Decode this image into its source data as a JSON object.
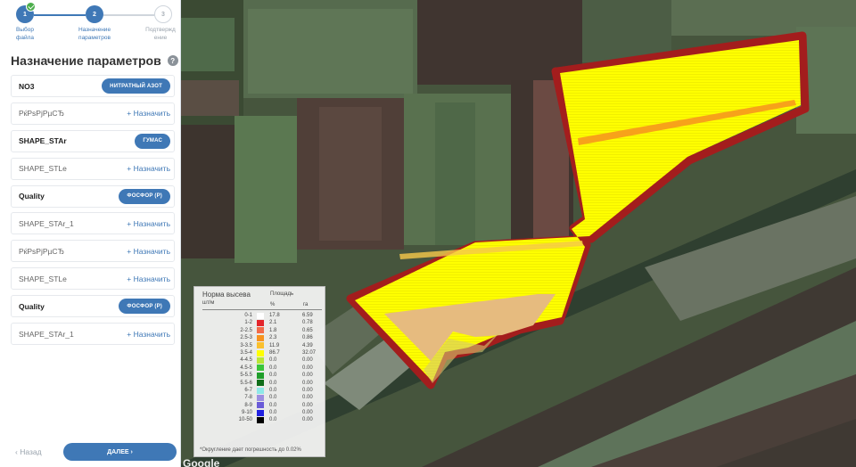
{
  "stepper": {
    "steps": [
      {
        "number": "1",
        "label_line1": "Выбор",
        "label_line2": "файла",
        "state": "done"
      },
      {
        "number": "2",
        "label_line1": "Назначение",
        "label_line2": "параметров",
        "state": "active"
      },
      {
        "number": "3",
        "label_line1": "Подтвержд",
        "label_line2": "ение",
        "state": "pending"
      }
    ]
  },
  "panel": {
    "title": "Назначение параметров",
    "help_icon": "?",
    "assign_label": "+ Назначить",
    "params": [
      {
        "name": "NO3",
        "assigned": true,
        "pill": "НИТРАТНЫЙ АЗОТ"
      },
      {
        "name": "РќРѕРјРµСЂ",
        "assigned": false
      },
      {
        "name": "SHAPE_STAr",
        "assigned": true,
        "pill": "ГУМАС"
      },
      {
        "name": "SHAPE_STLe",
        "assigned": false
      },
      {
        "name": "Quality",
        "assigned": true,
        "pill": "ФОСФОР (P)"
      },
      {
        "name": "SHAPE_STAr_1",
        "assigned": false
      },
      {
        "name": "РќРѕРјРµСЂ",
        "assigned": false
      },
      {
        "name": "SHAPE_STLe",
        "assigned": false
      },
      {
        "name": "Quality",
        "assigned": true,
        "pill": "ФОСФОР (P)"
      },
      {
        "name": "SHAPE_STAr_1",
        "assigned": false
      }
    ],
    "back_label": "‹ Назад",
    "next_label": "ДАЛЕЕ ›"
  },
  "map": {
    "google_logo": "Google"
  },
  "legend": {
    "header_rate_line1": "Норма высева",
    "header_rate_line2": "шт/м",
    "header_area": "Площадь",
    "col_pct": "%",
    "col_ha": "га",
    "rows": [
      {
        "range": "0-1",
        "color": "#ffffff",
        "pct": "17.8",
        "ha": "6.59"
      },
      {
        "range": "1-2",
        "color": "#e3242b",
        "pct": "2.1",
        "ha": "0.78"
      },
      {
        "range": "2-2.5",
        "color": "#f26b4a",
        "pct": "1.8",
        "ha": "0.65"
      },
      {
        "range": "2.5-3",
        "color": "#f7931e",
        "pct": "2.3",
        "ha": "0.86"
      },
      {
        "range": "3-3.5",
        "color": "#fbc02d",
        "pct": "11.9",
        "ha": "4.39"
      },
      {
        "range": "3.5-4",
        "color": "#ffff00",
        "pct": "86.7",
        "ha": "32.07"
      },
      {
        "range": "4-4.5",
        "color": "#b8e636",
        "pct": "0.0",
        "ha": "0.00"
      },
      {
        "range": "4.5-5",
        "color": "#39c539",
        "pct": "0.0",
        "ha": "0.00"
      },
      {
        "range": "5-5.5",
        "color": "#1f9e2a",
        "pct": "0.0",
        "ha": "0.00"
      },
      {
        "range": "5.5-6",
        "color": "#0f6e1a",
        "pct": "0.0",
        "ha": "0.00"
      },
      {
        "range": "6-7",
        "color": "#8fe8e8",
        "pct": "0.0",
        "ha": "0.00"
      },
      {
        "range": "7-8",
        "color": "#9c8fe0",
        "pct": "0.0",
        "ha": "0.00"
      },
      {
        "range": "8-9",
        "color": "#6a5bd8",
        "pct": "0.0",
        "ha": "0.00"
      },
      {
        "range": "9-10",
        "color": "#2020e0",
        "pct": "0.0",
        "ha": "0.00"
      },
      {
        "range": "10-50",
        "color": "#000000",
        "pct": "0.0",
        "ha": "0.00"
      }
    ],
    "note": "*Округление дает погрешность до 0.02%"
  }
}
